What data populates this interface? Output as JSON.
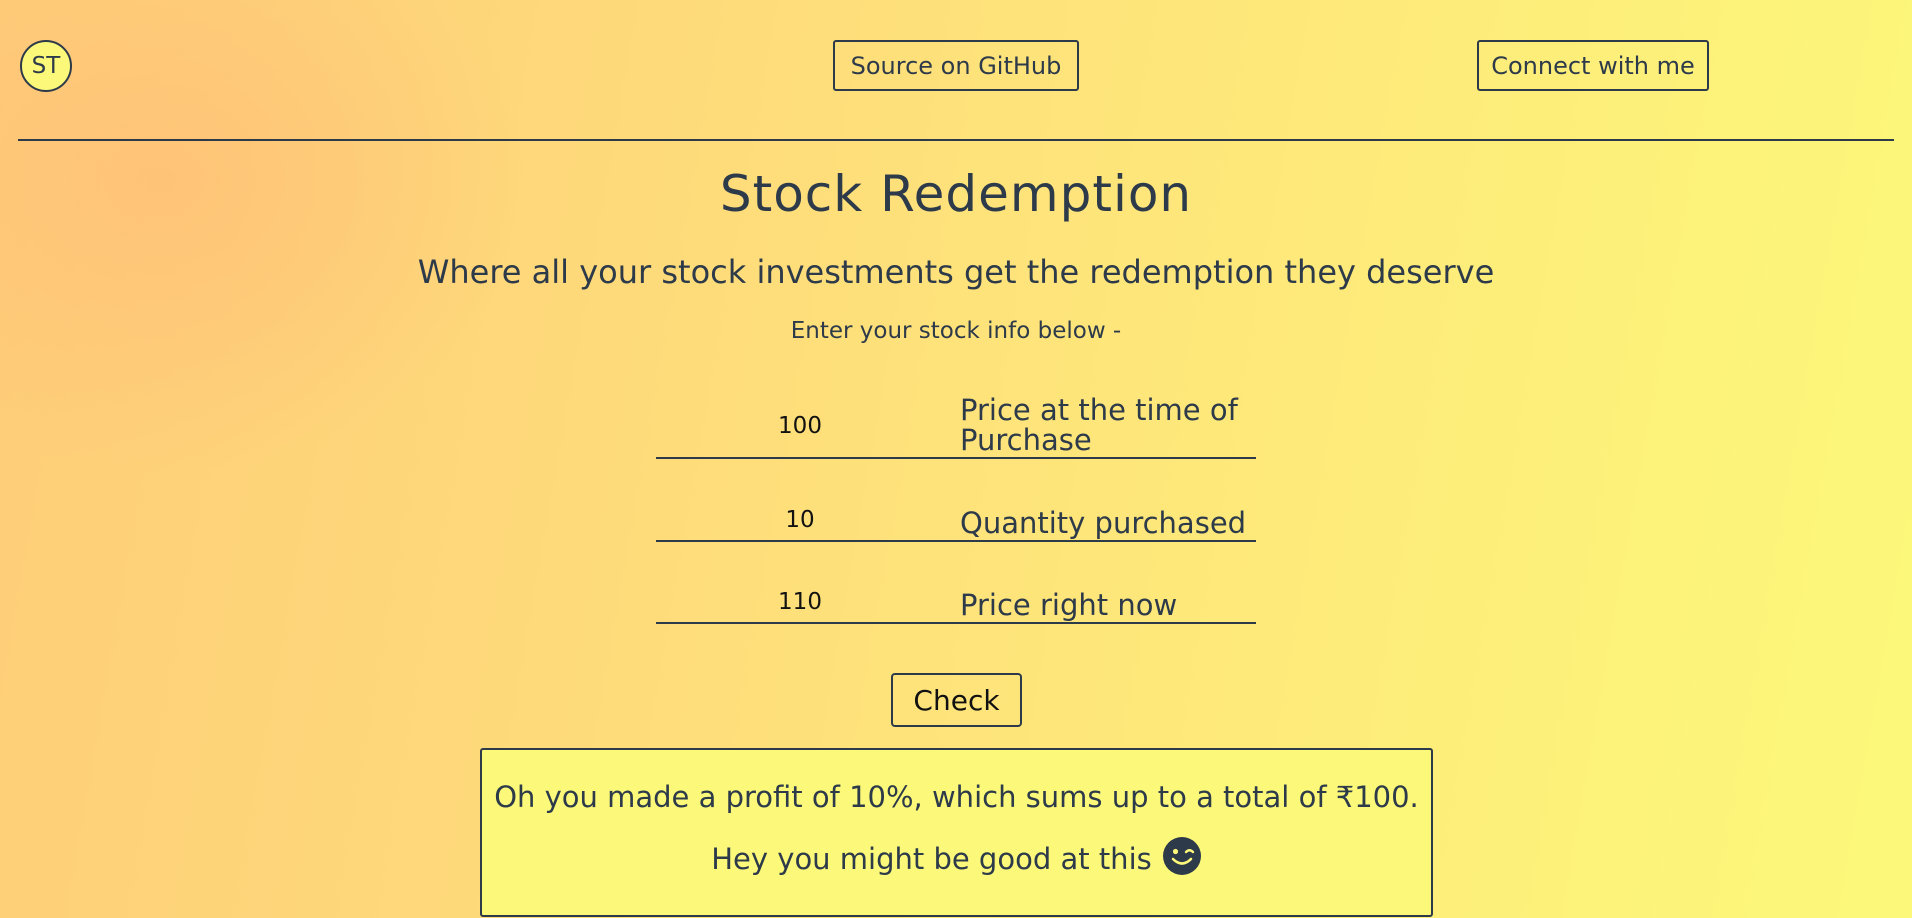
{
  "nav": {
    "avatar_initials": "ST",
    "github_label": "Source on GitHub",
    "connect_label": "Connect with me"
  },
  "header": {
    "title": "Stock Redemption",
    "subtitle": "Where all your stock investments get the redemption they deserve",
    "prompt": "Enter your stock info below -"
  },
  "form": {
    "fields": [
      {
        "value": "100",
        "label": "Price at the time of Purchase"
      },
      {
        "value": "10",
        "label": "Quantity purchased"
      },
      {
        "value": "110",
        "label": "Price right now"
      }
    ],
    "check_label": "Check"
  },
  "result": {
    "line1": "Oh you made a profit of 10%, which sums up to a total of ₹100.",
    "line2": "Hey you might be good at this",
    "icon": "wink-emoji-icon"
  },
  "colors": {
    "text": "#2d3a4a",
    "background_start": "#fecd78",
    "background_end": "#fcf97a",
    "result_bg": "#fcf97a"
  }
}
